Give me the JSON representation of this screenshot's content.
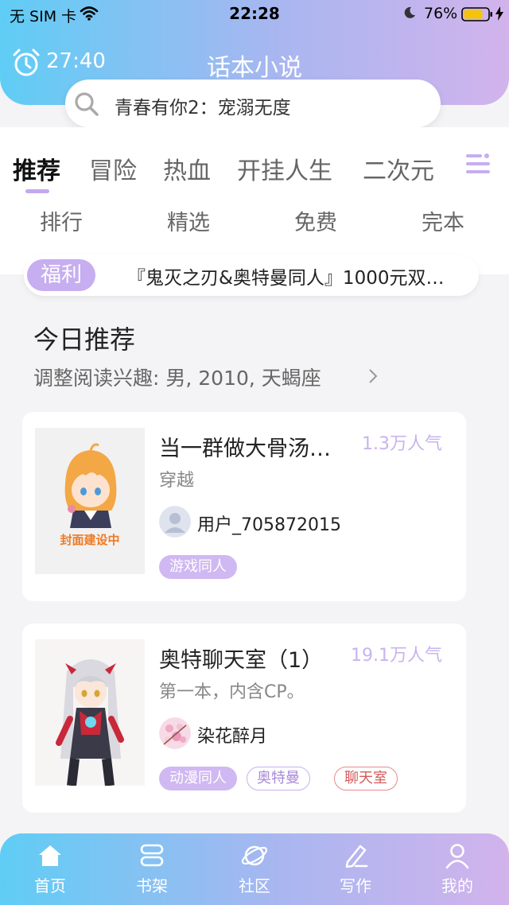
{
  "status_bar": {
    "carrier": "无 SIM 卡",
    "time": "22:28",
    "battery": "76%"
  },
  "header": {
    "timer": "27:40",
    "title": "话本小说",
    "search_text": "青春有你2：宠溺无度"
  },
  "tabs": [
    {
      "label": "推荐",
      "active": true
    },
    {
      "label": "冒险",
      "active": false
    },
    {
      "label": "热血",
      "active": false
    },
    {
      "label": "开挂人生",
      "active": false
    },
    {
      "label": "二次元",
      "active": false
    }
  ],
  "sub_nav": [
    "排行",
    "精选",
    "免费",
    "完本"
  ],
  "notice": {
    "badge": "福利",
    "text": "『鬼灭之刃&奥特曼同人』1000元双…"
  },
  "recommend": {
    "title": "今日推荐",
    "interest": "调整阅读兴趣: 男, 2010, 天蝎座"
  },
  "books": [
    {
      "title": "当一群做大骨汤…",
      "popularity": "1.3万人气",
      "desc": "穿越",
      "author": "用户_705872015",
      "cover_text": "封面建设中",
      "tags": [
        "游戏同人"
      ]
    },
    {
      "title": "奥特聊天室（1）",
      "popularity": "19.1万人气",
      "desc": "第一本，内含CP。",
      "author": "染花醉月",
      "tags": [
        "动漫同人",
        "奥特曼",
        "聊天室"
      ]
    }
  ],
  "bottom_nav": [
    "首页",
    "书架",
    "社区",
    "写作",
    "我的"
  ],
  "colors": {
    "gradient_start": "#5fcdf5",
    "gradient_end": "#d2b3ec",
    "accent_purple": "#c6aef0",
    "tag_red": "#d65a5a"
  }
}
